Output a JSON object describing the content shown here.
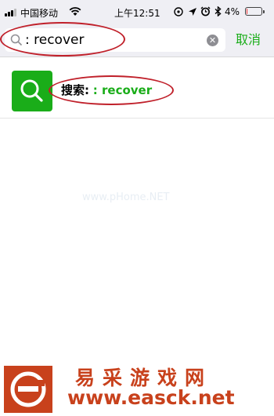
{
  "status_bar": {
    "carrier": "中国移动",
    "time": "上午12:51",
    "battery": "4%",
    "battery_level": 0.04
  },
  "search": {
    "query": ": recover",
    "cancel_label": "取消"
  },
  "result": {
    "label": "搜索:",
    "keyword": ": recover"
  },
  "watermark": {
    "middle": "www.pHome.NET",
    "title": "易采游戏网",
    "url": "www.easck.net"
  },
  "colors": {
    "accent": "#1aad19",
    "annotation": "#c0202a",
    "watermark": "#c8411c"
  }
}
